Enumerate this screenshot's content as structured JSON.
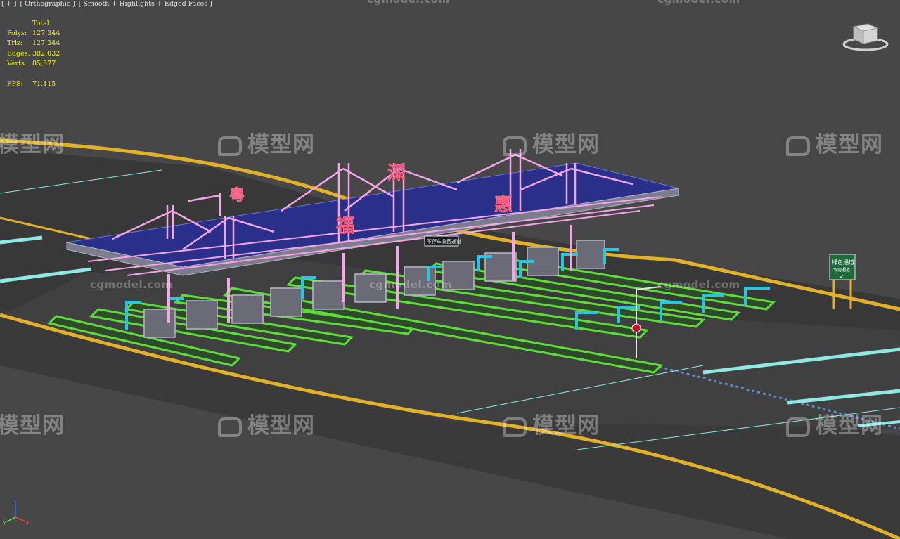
{
  "viewport": {
    "label_parts": [
      "[ + ]",
      "[ Orthographic ]",
      "[ Smooth + Highlights + Edged Faces ]"
    ]
  },
  "stats": {
    "header": "Total",
    "polys_label": "Polys:",
    "polys_value": "127,344",
    "tris_label": "Tris:",
    "tris_value": "127,344",
    "edges_label": "Edges:",
    "edges_value": "382,032",
    "verts_label": "Verts:",
    "verts_value": "85,577",
    "fps_label": "FPS:",
    "fps_value": "71.115"
  },
  "watermarks": {
    "brand": "模型网",
    "site": "cgmodel.com"
  },
  "scene": {
    "canopy_chars": [
      "粤",
      "福",
      "深",
      "惠"
    ],
    "sign_board": "绿色通道",
    "sign_board_sub": "专用通道",
    "canopy_sign": "不停车收费通道"
  },
  "colors": {
    "hud_text": "#f5f500",
    "viewport_bg": "#474747",
    "canopy": "#2a2f8a",
    "truss": "#f5a6e8",
    "booth_outline": "#28c6e0",
    "island": "#5ddc3a",
    "road_edge": "#e2b12a",
    "lane_line": "#8fe8e2"
  },
  "icons": {
    "viewcube": "viewcube-icon",
    "axis": "axis-tripod-icon"
  }
}
